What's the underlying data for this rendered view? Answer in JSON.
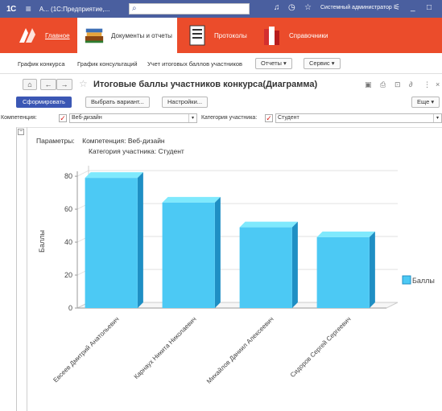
{
  "titlebar": {
    "logo": "1С",
    "app_title": "А... (1С:Предприятие,...",
    "user": "Системный администратор"
  },
  "sections": {
    "items": [
      {
        "label": "Главное"
      },
      {
        "label": "Документы и отчеты"
      },
      {
        "label": "Протоколы"
      },
      {
        "label": "Справочники"
      }
    ]
  },
  "command_menu": {
    "links": [
      "График конкурса",
      "График консультаций",
      "Учет итоговых баллов участников"
    ],
    "reports_button": "Отчеты ▾",
    "service_button": "Сервис ▾"
  },
  "form": {
    "title": "Итоговые баллы участников конкурса(Диаграмма)",
    "generate_button": "Сформировать",
    "choose_variant_button": "Выбрать вариант...",
    "settings_button": "Настройки...",
    "more_button": "Еще ▾"
  },
  "filters": {
    "competence_label": "Компетенция:",
    "competence_value": "Веб-дизайн",
    "category_label": "Категория участника:",
    "category_value": "Студент"
  },
  "report": {
    "params_label": "Параметры:",
    "params_line1": "Компетенция: Веб-дизайн",
    "params_line2": "Категория участника: Студент"
  },
  "colors": {
    "titlebar": "#4a5f9f",
    "sections_bar": "#eb4c2b",
    "bar_front": "#4cc9f4",
    "bar_top": "#7fe9fd",
    "bar_side": "#1f8fc4",
    "primary_button": "#3b57b4"
  },
  "chart_data": {
    "type": "bar",
    "categories": [
      "Евсеев Дмитрий Анатольевич",
      "Карнаух Никита Николаевич",
      "Михайлов Даниил Алексеевич",
      "Сидоров Сергей Сергеевич"
    ],
    "series": [
      {
        "name": "Баллы",
        "values": [
          79,
          64,
          49,
          43
        ]
      }
    ],
    "ylabel": "Баллы",
    "yticks": [
      0,
      20,
      40,
      60,
      80
    ],
    "ylim": [
      0,
      82
    ],
    "grid": true,
    "legend": "right",
    "style": "3d"
  }
}
